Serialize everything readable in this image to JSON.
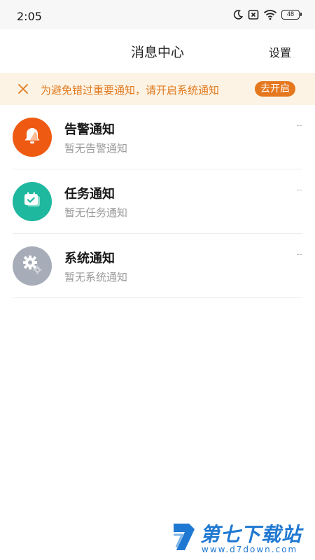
{
  "status_bar": {
    "time": "2:05",
    "battery": "48"
  },
  "header": {
    "title": "消息中心",
    "settings_label": "设置"
  },
  "banner": {
    "text": "为避免错过重要通知，请开启系统通知",
    "button_label": "去开启"
  },
  "notifications": [
    {
      "title": "告警通知",
      "subtitle": "暂无告警通知",
      "time": "--",
      "icon": "bell-icon",
      "color": "#ef5a12"
    },
    {
      "title": "任务通知",
      "subtitle": "暂无任务通知",
      "time": "--",
      "icon": "calendar-check-icon",
      "color": "#1eb89e"
    },
    {
      "title": "系统通知",
      "subtitle": "暂无系统通知",
      "time": "--",
      "icon": "gear-icon",
      "color": "#a7adb8"
    }
  ],
  "watermark": {
    "name": "第七下载站",
    "url": "www.d7down.com"
  }
}
